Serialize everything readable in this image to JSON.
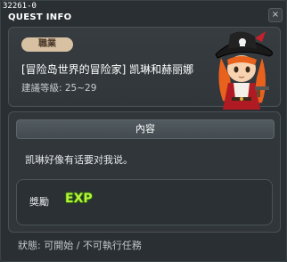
{
  "window": {
    "quest_id": "32261-0",
    "title": "QUEST INFO",
    "close_label": "×"
  },
  "info": {
    "job_badge": "職業",
    "quest_name": "[冒险岛世界的冒险家] 凯琳和赫丽娜",
    "level_text": "建議等級: 25~29",
    "npc_image": "pirate-girl-npc-portrait"
  },
  "content": {
    "header": "內容",
    "text": "凯琳好像有话要对我说。",
    "reward": {
      "label": "獎勵",
      "icon": "EXP"
    }
  },
  "status": {
    "text": "狀態: 可開始 / 不可執行任務"
  },
  "colors": {
    "exp_green": "#b6f33a",
    "badge_tan": "#d8c1a3",
    "panel_bg": "#30363a"
  }
}
